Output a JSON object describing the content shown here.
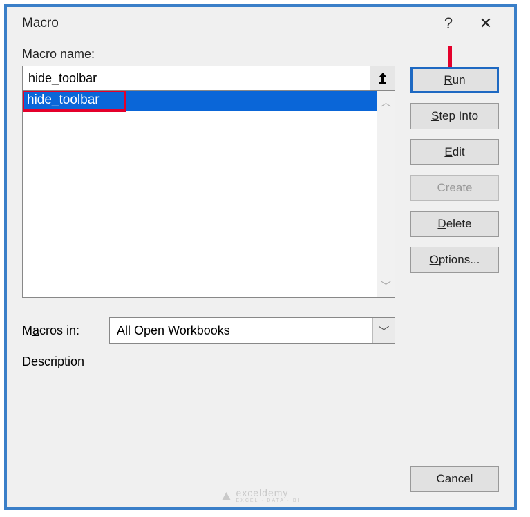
{
  "titlebar": {
    "title": "Macro",
    "help": "?",
    "close": "✕"
  },
  "labels": {
    "macro_name": "Macro name:",
    "macros_in": "Macros in:",
    "description": "Description"
  },
  "inputs": {
    "macro_name_value": "hide_toolbar",
    "macros_in_value": "All Open Workbooks"
  },
  "list": {
    "items": [
      "hide_toolbar"
    ]
  },
  "buttons": {
    "run": "Run",
    "step_into": "Step Into",
    "edit": "Edit",
    "create": "Create",
    "delete": "Delete",
    "options": "Options...",
    "cancel": "Cancel"
  },
  "watermark": {
    "name": "exceldemy",
    "sub": "EXCEL · DATA · BI"
  }
}
